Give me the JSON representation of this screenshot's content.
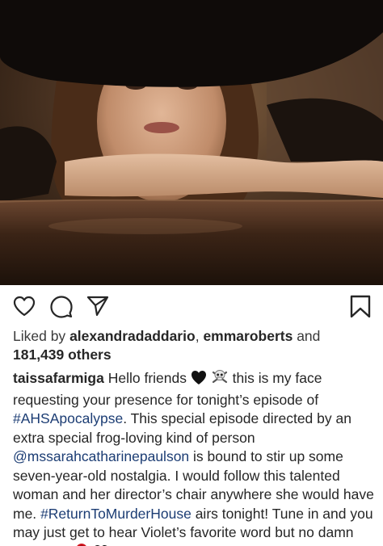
{
  "post": {
    "likes": {
      "prefix": "Liked by",
      "user1": "alexandradaddario",
      "separator": ",",
      "user2": "emmaroberts",
      "and_word": "and",
      "others_count": "181,439 others"
    },
    "caption": {
      "username": "taissafarmiga",
      "t1": "Hello friends",
      "t2": "this is my face requesting your presence for tonight’s episode of",
      "tag1": "#AHSApocalypse",
      "t3": ". This special episode directed by an extra special frog-loving kind of person",
      "mention": "@mssarahcatharinepaulson",
      "t4": "is bound to stir up some seven-year-old nostalgia. I would follow this talented woman and her director’s chair anywhere she would have me.",
      "tag2": "#ReturnToMurderHouse",
      "t5": "airs tonight! Tune in and you may just get to hear Violet’s favorite word but no damn promises",
      "emojis": [
        "black-heart",
        "skull-crossbones",
        "rose",
        "black-heart"
      ]
    },
    "actions": [
      "heart-icon",
      "comment-icon",
      "share-icon",
      "bookmark-icon"
    ]
  },
  "colors": {
    "hashtag": "#1c3d74",
    "text": "#262626"
  }
}
